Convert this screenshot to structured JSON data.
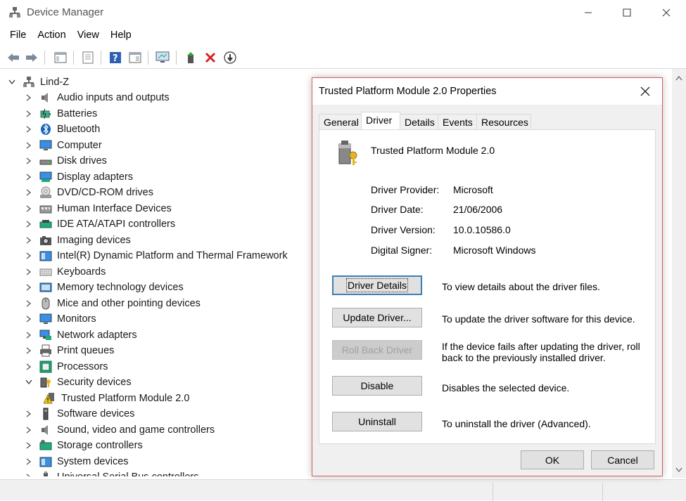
{
  "window": {
    "title": "Device Manager",
    "controls": [
      "minimize",
      "maximize",
      "close"
    ]
  },
  "menu": [
    "File",
    "Action",
    "View",
    "Help"
  ],
  "toolbar": {
    "icons": [
      "back-arrow-icon",
      "forward-arrow-icon",
      "show-hide-tree-icon",
      "properties-icon",
      "help-icon",
      "view-icon",
      "monitor-scan-icon",
      "update-driver-icon",
      "uninstall-x-icon",
      "disable-download-icon"
    ]
  },
  "tree": {
    "root": "Lind-Z",
    "items": [
      {
        "label": "Audio inputs and outputs",
        "icon": "speaker-icon"
      },
      {
        "label": "Batteries",
        "icon": "battery-icon"
      },
      {
        "label": "Bluetooth",
        "icon": "bluetooth-icon"
      },
      {
        "label": "Computer",
        "icon": "computer-icon"
      },
      {
        "label": "Disk drives",
        "icon": "disk-icon"
      },
      {
        "label": "Display adapters",
        "icon": "display-adapter-icon"
      },
      {
        "label": "DVD/CD-ROM drives",
        "icon": "dvd-icon"
      },
      {
        "label": "Human Interface Devices",
        "icon": "hid-icon"
      },
      {
        "label": "IDE ATA/ATAPI controllers",
        "icon": "ide-icon"
      },
      {
        "label": "Imaging devices",
        "icon": "camera-icon"
      },
      {
        "label": "Intel(R) Dynamic Platform and Thermal Framework",
        "icon": "chip-folder-icon"
      },
      {
        "label": "Keyboards",
        "icon": "keyboard-icon"
      },
      {
        "label": "Memory technology devices",
        "icon": "memory-icon"
      },
      {
        "label": "Mice and other pointing devices",
        "icon": "mouse-icon"
      },
      {
        "label": "Monitors",
        "icon": "monitor-icon"
      },
      {
        "label": "Network adapters",
        "icon": "network-icon"
      },
      {
        "label": "Print queues",
        "icon": "printer-icon"
      },
      {
        "label": "Processors",
        "icon": "processor-icon"
      },
      {
        "label": "Security devices",
        "icon": "security-icon",
        "expanded": true
      },
      {
        "label": "Trusted Platform Module 2.0",
        "icon": "warning-tpm-icon",
        "child": true
      },
      {
        "label": "Software devices",
        "icon": "software-device-icon"
      },
      {
        "label": "Sound, video and game controllers",
        "icon": "speaker-icon"
      },
      {
        "label": "Storage controllers",
        "icon": "storage-icon"
      },
      {
        "label": "System devices",
        "icon": "system-folder-icon"
      },
      {
        "label": "Universal Serial Bus controllers",
        "icon": "usb-icon"
      }
    ]
  },
  "dialog": {
    "title": "Trusted Platform Module 2.0 Properties",
    "tabs": [
      "General",
      "Driver",
      "Details",
      "Events",
      "Resources"
    ],
    "active_tab": "Driver",
    "device_name": "Trusted Platform Module 2.0",
    "info": [
      {
        "label": "Driver Provider:",
        "value": "Microsoft"
      },
      {
        "label": "Driver Date:",
        "value": "21/06/2006"
      },
      {
        "label": "Driver Version:",
        "value": "10.0.10586.0"
      },
      {
        "label": "Digital Signer:",
        "value": "Microsoft Windows"
      }
    ],
    "actions": [
      {
        "button": "Driver Details",
        "desc": "To view details about the driver files.",
        "focused": true
      },
      {
        "button": "Update Driver...",
        "desc": "To update the driver software for this device."
      },
      {
        "button": "Roll Back Driver",
        "desc": "If the device fails after updating the driver, roll back to the previously installed driver.",
        "disabled": true
      },
      {
        "button": "Disable",
        "desc": "Disables the selected device."
      },
      {
        "button": "Uninstall",
        "desc": "To uninstall the driver (Advanced)."
      }
    ],
    "ok": "OK",
    "cancel": "Cancel"
  },
  "colors": {
    "dialog_border": "#d85a5a",
    "focus_border": "#3c7fb1",
    "window_bg": "#f0f0f0"
  }
}
